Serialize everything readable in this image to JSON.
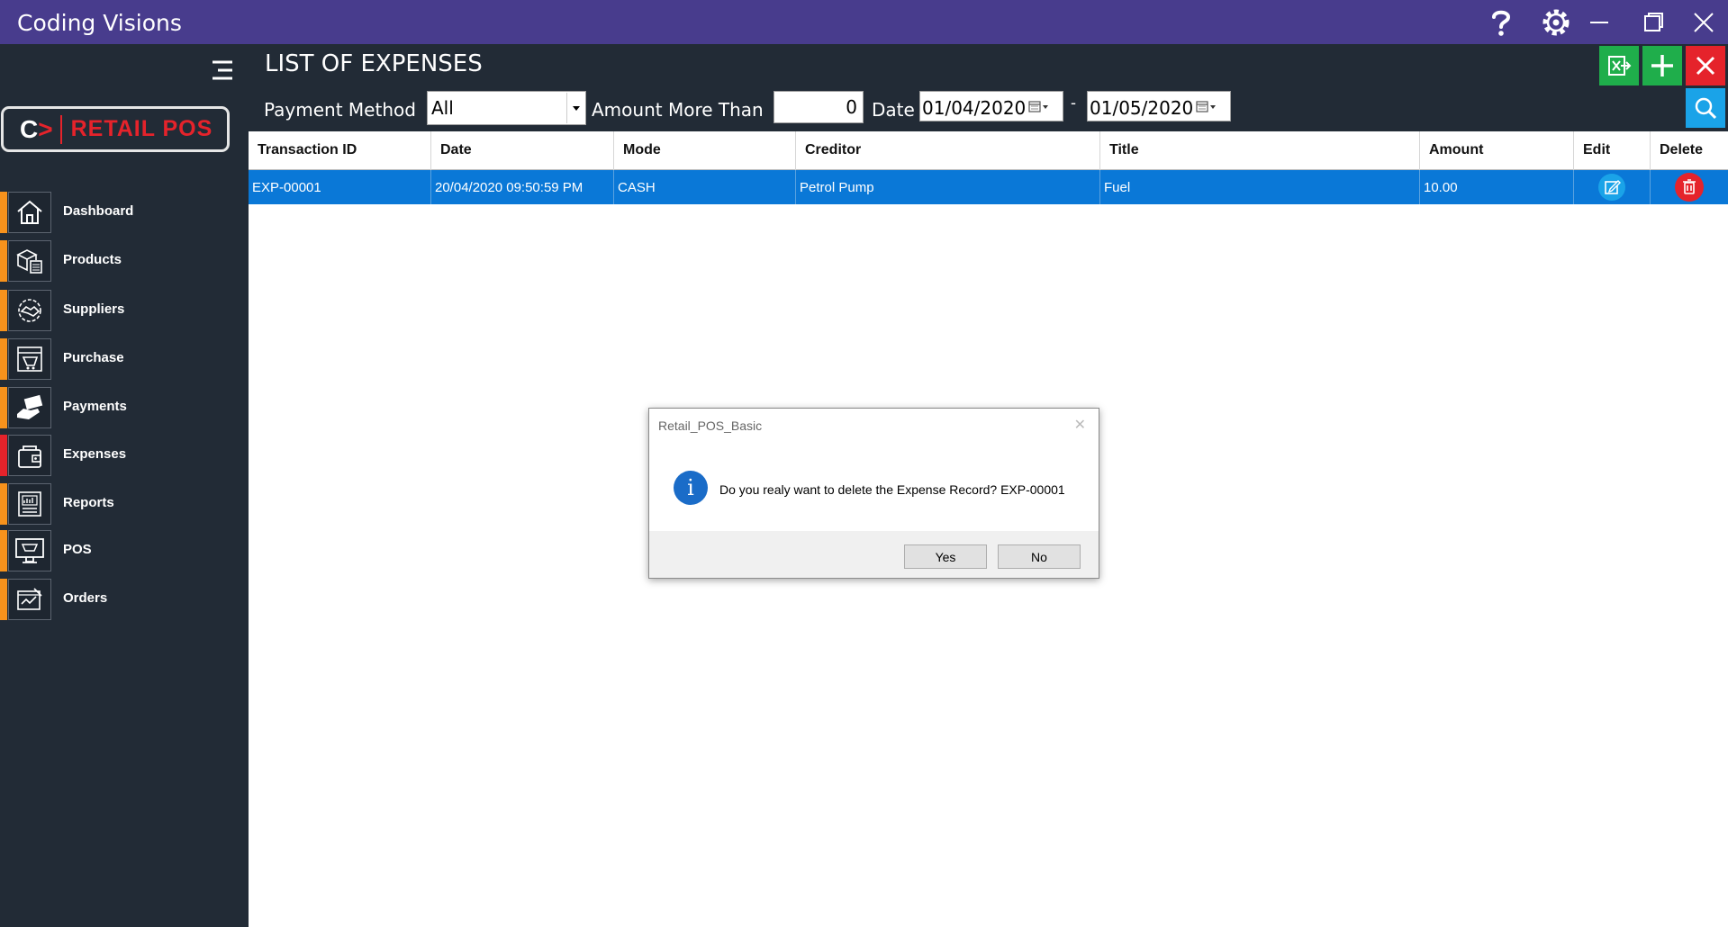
{
  "window": {
    "title": "Coding Visions"
  },
  "logo": {
    "letter": "C",
    "arrow": ">",
    "text": "RETAIL POS"
  },
  "sidebar": {
    "items": [
      {
        "label": "Dashboard",
        "icon": "home-icon"
      },
      {
        "label": "Products",
        "icon": "boxes-icon"
      },
      {
        "label": "Suppliers",
        "icon": "handshake-icon"
      },
      {
        "label": "Purchase",
        "icon": "cart-list-icon"
      },
      {
        "label": "Payments",
        "icon": "payment-hand-icon"
      },
      {
        "label": "Expenses",
        "icon": "wallet-icon",
        "active": true
      },
      {
        "label": "Reports",
        "icon": "report-icon"
      },
      {
        "label": "POS",
        "icon": "pos-terminal-icon"
      },
      {
        "label": "Orders",
        "icon": "orders-icon"
      }
    ]
  },
  "header": {
    "title": "LIST OF EXPENSES",
    "payment_method_label": "Payment Method",
    "payment_method_value": "All",
    "amount_label": "Amount More Than",
    "amount_value": "0",
    "date_label": "Date",
    "date_from": "01/04/2020",
    "date_separator": "-",
    "date_to": "01/05/2020"
  },
  "grid": {
    "columns": [
      "Transaction ID",
      "Date",
      "Mode",
      "Creditor",
      "Title",
      "Amount",
      "Edit",
      "Delete"
    ],
    "rows": [
      {
        "transaction_id": "EXP-00001",
        "date": "20/04/2020 09:50:59 PM",
        "mode": "CASH",
        "creditor": "Petrol Pump",
        "title": "Fuel",
        "amount": "10.00"
      }
    ]
  },
  "dialog": {
    "title": "Retail_POS_Basic",
    "close_glyph": "✕",
    "info_glyph": "i",
    "message": "Do you realy want to delete the Expense Record? EXP-00001",
    "yes_label": "Yes",
    "no_label": "No"
  },
  "colors": {
    "titlebar": "#483c8d",
    "sidebar": "#222b36",
    "accent_orange": "#f7921c",
    "active_red": "#e5232b",
    "row_selected": "#0a78d7",
    "excel_green": "#1fae4b",
    "add_green": "#1fae4b",
    "close_red": "#e5232b",
    "search_cyan": "#1aa3e8"
  }
}
